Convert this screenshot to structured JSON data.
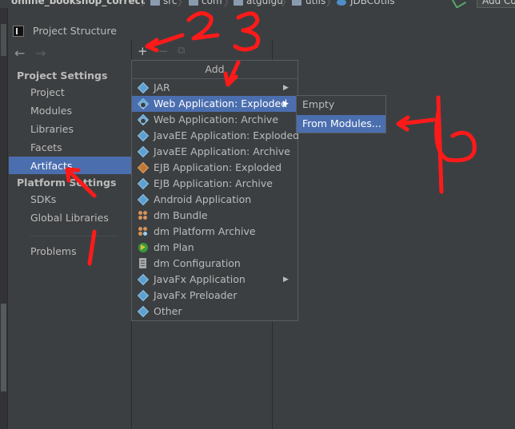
{
  "breadcrumb": {
    "items": [
      "online_bookshop_correct",
      "src",
      "com",
      "atguigu",
      "utils",
      "JDBCUtils"
    ],
    "add_config_label": "Add Co"
  },
  "dialog": {
    "title": "Project Structure",
    "nav": {
      "back": "←",
      "forward": "→"
    },
    "toolbar": {
      "add": "+",
      "remove": "−",
      "copy": "⧉"
    }
  },
  "sidebar": {
    "project_settings_header": "Project Settings",
    "project_settings_items": [
      "Project",
      "Modules",
      "Libraries",
      "Facets",
      "Artifacts"
    ],
    "selected": "Artifacts",
    "platform_settings_header": "Platform Settings",
    "platform_settings_items": [
      "SDKs",
      "Global Libraries"
    ],
    "problems": "Problems"
  },
  "add_popup": {
    "title": "Add",
    "items": [
      {
        "label": "JAR",
        "icon": "jar-icon",
        "submenu": true
      },
      {
        "label": "Web Application: Exploded",
        "icon": "web-app-exploded-icon",
        "submenu": true,
        "selected": true
      },
      {
        "label": "Web Application: Archive",
        "icon": "web-app-archive-icon"
      },
      {
        "label": "JavaEE Application: Exploded",
        "icon": "javaee-exploded-icon"
      },
      {
        "label": "JavaEE Application: Archive",
        "icon": "javaee-archive-icon"
      },
      {
        "label": "EJB Application: Exploded",
        "icon": "ejb-exploded-icon"
      },
      {
        "label": "EJB Application: Archive",
        "icon": "ejb-archive-icon"
      },
      {
        "label": "Android Application",
        "icon": "android-icon"
      },
      {
        "label": "dm Bundle",
        "icon": "bundle-icon"
      },
      {
        "label": "dm Platform Archive",
        "icon": "platform-archive-icon"
      },
      {
        "label": "dm Plan",
        "icon": "plan-icon"
      },
      {
        "label": "dm Configuration",
        "icon": "configuration-icon"
      },
      {
        "label": "JavaFx Application",
        "icon": "javafx-icon",
        "submenu": true
      },
      {
        "label": "JavaFx Preloader",
        "icon": "javafx-preloader-icon"
      },
      {
        "label": "Other",
        "icon": "other-icon"
      }
    ]
  },
  "submenu": {
    "items": [
      {
        "label": "Empty"
      },
      {
        "label": "From Modules...",
        "selected": true
      }
    ]
  },
  "annotations": {
    "labels": [
      "1",
      "2",
      "3",
      "4"
    ],
    "color": "#ff1a1a"
  },
  "colors": {
    "background": "#3c3f41",
    "selection": "#4b6eaf",
    "text": "#bbbbbb"
  }
}
